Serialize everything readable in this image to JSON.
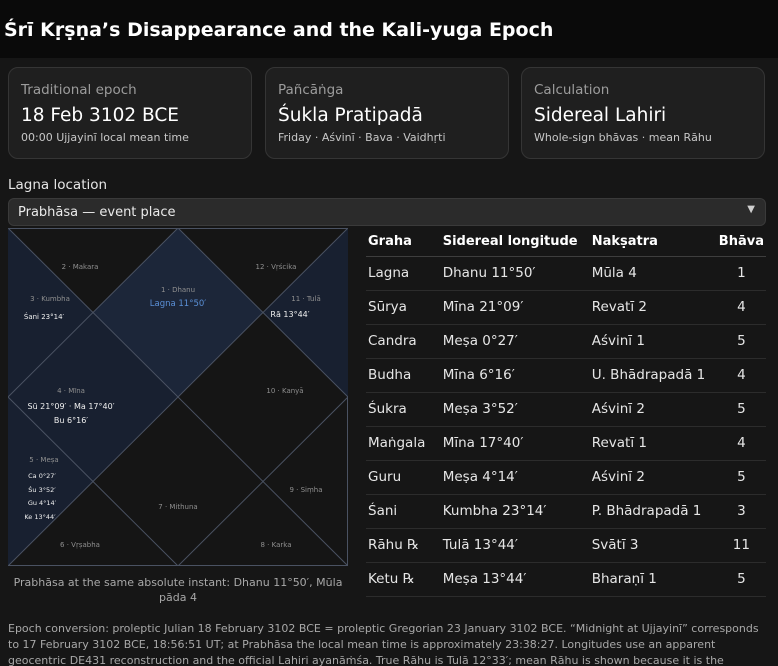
{
  "page": {
    "title": "Śrī Kṛṣṇa’s Disappearance and the Kali-yuga Epoch"
  },
  "cards": [
    {
      "label": "Traditional epoch",
      "value": "18 Feb 3102 BCE",
      "sub": "00:00 Ujjayinī local mean time"
    },
    {
      "label": "Pañcāṅga",
      "value": "Śukla Pratipadā",
      "sub": "Friday · Aśvinī · Bava · Vaidhṛti"
    },
    {
      "label": "Calculation",
      "value": "Sidereal Lahiri",
      "sub": "Whole-sign bhāvas · mean Rāhu"
    }
  ],
  "location": {
    "label": "Lagna location",
    "selected": "Prabhāsa — event place"
  },
  "chart": {
    "house_labels": [
      "1 · Dhanu",
      "2 · Makara",
      "3 · Kumbha",
      "4 · Mīna",
      "5 · Meṣa",
      "6 · Vṛṣabha",
      "7 · Mithuna",
      "8 · Karka",
      "9 · Siṃha",
      "10 · Kanyā",
      "11 · Tulā",
      "12 · Vṛścika"
    ],
    "lagna_mark": "Lagna 11°50′",
    "h3_planets": [
      "Śani 23°14′"
    ],
    "h4_planets": [
      "Sū 21°09′ · Ma 17°40′",
      "Bu 6°16′"
    ],
    "h5_planets": [
      "Ca 0°27′",
      "Śu 3°52′",
      "Gu 4°14′",
      "Ke 13°44′"
    ],
    "h11_planets": [
      "Rā 13°44′"
    ],
    "caption": "Prabhāsa at the same absolute instant: Dhanu 11°50′, Mūla pāda 4",
    "colors": {
      "lagna_house": "#1c2639",
      "lagna_text": "#5a8fd6",
      "line": "#4a5262",
      "bg": "#151515"
    }
  },
  "table": {
    "headers": [
      "Graha",
      "Sidereal longitude",
      "Nakṣatra",
      "Bhāva"
    ],
    "rows": [
      [
        "Lagna",
        "Dhanu 11°50′",
        "Mūla 4",
        "1"
      ],
      [
        "Sūrya",
        "Mīna 21°09′",
        "Revatī 2",
        "4"
      ],
      [
        "Candra",
        "Meṣa 0°27′",
        "Aśvinī 1",
        "5"
      ],
      [
        "Budha",
        "Mīna 6°16′",
        "U. Bhādrapadā 1",
        "4"
      ],
      [
        "Śukra",
        "Meṣa 3°52′",
        "Aśvinī 2",
        "5"
      ],
      [
        "Maṅgala",
        "Mīna 17°40′",
        "Revatī 1",
        "4"
      ],
      [
        "Guru",
        "Meṣa 4°14′",
        "Aśvinī 2",
        "5"
      ],
      [
        "Śani",
        "Kumbha 23°14′",
        "P. Bhādrapadā 1",
        "3"
      ],
      [
        "Rāhu ℞",
        "Tulā 13°44′",
        "Svātī 3",
        "11"
      ],
      [
        "Ketu ℞",
        "Meṣa 13°44′",
        "Bharaṇī 1",
        "5"
      ]
    ]
  },
  "footnote": "Epoch conversion: proleptic Julian 18 February 3102 BCE = proleptic Gregorian 23 January 3102 BCE. “Midnight at Ujjayinī” corresponds to 17 February 3102 BCE, 18:56:51 UT; at Prabhāsa the local mean time is approximately 23:38:27. Longitudes use an apparent geocentric DE431 reconstruction and the official Lahiri ayanāṁśa. True Rāhu is Tulā 12°33′; mean Rāhu is shown because it is the conventional Jyotiṣa default."
}
